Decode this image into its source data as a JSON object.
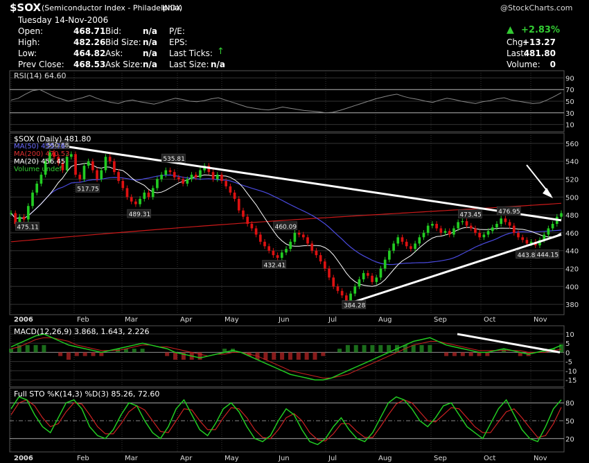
{
  "header": {
    "symbol": "$SOX",
    "name": "(Semiconductor Index - Philadelphia)",
    "exchange": "INDX",
    "watermark": "@StockCharts.com",
    "date": "Tuesday 14-Nov-2006",
    "quote": {
      "open_label": "Open:",
      "open": "468.71",
      "high_label": "High:",
      "high": "482.26",
      "low_label": "Low:",
      "low": "464.82",
      "prev_label": "Prev Close:",
      "prev": "468.53",
      "bid_label": "Bid:",
      "bid": "n/a",
      "bidsize_label": "Bid Size:",
      "bidsize": "n/a",
      "ask_label": "Ask:",
      "ask": "n/a",
      "asksize_label": "Ask Size:",
      "asksize": "n/a",
      "pe_label": "P/E:",
      "eps_label": "EPS:",
      "lastticks_label": "Last Ticks:",
      "lastsize_label": "Last Size:",
      "lastsize": "n/a",
      "pct": "+2.83%",
      "chg_label": "Chg:",
      "chg": "+13.27",
      "last_label": "Last:",
      "last": "481.80",
      "vol_label": "Volume:",
      "vol": "0"
    }
  },
  "colors": {
    "up": "#22cc22",
    "down": "#dd1111",
    "ma50": "#4a4adf",
    "ma200": "#cc1a1a",
    "ma20": "#ffffff",
    "grid": "#333333",
    "panel": "#000000",
    "macd_line": "#22cc22",
    "signal": "#cc2222",
    "sto_k": "#22cc22",
    "sto_d": "#cc2222",
    "rsi": "#888888",
    "trend": "#ffffff"
  },
  "chart_data": [
    {
      "type": "line",
      "panel": "rsi",
      "legend": "RSI(14) 64.60",
      "yticks": [
        10,
        30,
        50,
        70,
        90
      ],
      "ylim": [
        0,
        100
      ],
      "refs": [
        30,
        70
      ],
      "values": [
        52,
        55,
        62,
        68,
        70,
        64,
        58,
        54,
        50,
        53,
        56,
        60,
        55,
        51,
        48,
        46,
        50,
        52,
        49,
        47,
        45,
        48,
        52,
        55,
        53,
        50,
        49,
        51,
        54,
        56,
        52,
        48,
        44,
        40,
        38,
        36,
        35,
        37,
        40,
        38,
        36,
        34,
        33,
        32,
        30,
        31,
        34,
        38,
        42,
        46,
        50,
        54,
        57,
        60,
        62,
        58,
        55,
        53,
        50,
        48,
        52,
        55,
        53,
        50,
        48,
        46,
        49,
        51,
        54,
        56,
        52,
        50,
        48,
        46,
        47,
        52,
        58,
        64.6
      ]
    },
    {
      "type": "candlestick",
      "panel": "price",
      "legend": [
        "$SOX (Daily) 481.80",
        "MA(50) 455.76",
        "MA(200) 470.53",
        "MA(20) 456.45",
        "Volume undef"
      ],
      "ylim": [
        370,
        570
      ],
      "yticks": [
        380,
        400,
        420,
        440,
        460,
        480,
        500,
        520,
        540,
        560
      ],
      "x_months": [
        "2006",
        "Feb",
        "Mar",
        "Apr",
        "May",
        "Jun",
        "Jul",
        "Aug",
        "Sep",
        "Oct",
        "Nov"
      ],
      "close": [
        482,
        470,
        478,
        475,
        490,
        505,
        515,
        525,
        540,
        550,
        545,
        538,
        530,
        545,
        548,
        525,
        520,
        535,
        540,
        530,
        520,
        530,
        545,
        540,
        528,
        518,
        510,
        500,
        495,
        492,
        498,
        505,
        500,
        510,
        520,
        525,
        530,
        528,
        522,
        520,
        515,
        520,
        525,
        522,
        530,
        535,
        528,
        520,
        525,
        518,
        512,
        505,
        498,
        485,
        478,
        470,
        465,
        458,
        450,
        445,
        440,
        435,
        432,
        438,
        442,
        450,
        460,
        458,
        455,
        448,
        440,
        435,
        428,
        420,
        410,
        400,
        395,
        390,
        384,
        392,
        400,
        408,
        415,
        412,
        405,
        410,
        420,
        430,
        440,
        448,
        455,
        450,
        445,
        442,
        448,
        455,
        460,
        468,
        470,
        465,
        460,
        462,
        458,
        465,
        472,
        473,
        468,
        465,
        460,
        455,
        458,
        462,
        466,
        470,
        476,
        472,
        468,
        460,
        455,
        452,
        448,
        450,
        446,
        452,
        458,
        465,
        470,
        478,
        482
      ],
      "annotations": [
        {
          "label": "475.11",
          "value": 475.11
        },
        {
          "label": "550.88",
          "value": 550.88
        },
        {
          "label": "517.75",
          "value": 517.75
        },
        {
          "label": "489.31",
          "value": 489.31
        },
        {
          "label": "535.81",
          "value": 535.81
        },
        {
          "label": "460.09",
          "value": 460.09
        },
        {
          "label": "432.41",
          "value": 432.41
        },
        {
          "label": "384.28",
          "value": 384.28
        },
        {
          "label": "473.45",
          "value": 473.45
        },
        {
          "label": "476.95",
          "value": 476.95
        },
        {
          "label": "443.81",
          "value": 443.81
        },
        {
          "label": "444.15",
          "value": 444.15
        }
      ]
    },
    {
      "type": "line",
      "panel": "macd",
      "legend": "MACD(12,26,9) 3.868, 1.643, 2.226",
      "ylim": [
        -18,
        13
      ],
      "yticks": [
        -15,
        -10,
        -5,
        0,
        5,
        10
      ],
      "values": [
        3,
        5,
        7,
        9,
        10,
        8,
        6,
        4,
        3,
        2,
        1,
        0,
        1,
        2,
        3,
        4,
        5,
        4,
        3,
        2,
        0,
        -1,
        -2,
        -3,
        -2,
        -1,
        0,
        1,
        0,
        -2,
        -4,
        -6,
        -8,
        -10,
        -12,
        -13,
        -14,
        -15,
        -15,
        -14,
        -12,
        -10,
        -8,
        -6,
        -4,
        -2,
        0,
        2,
        4,
        6,
        7,
        8,
        6,
        4,
        3,
        2,
        1,
        0,
        0,
        1,
        2,
        1,
        0,
        -1,
        0,
        1,
        2,
        3.868
      ],
      "signal": [
        2,
        3,
        5,
        7,
        8,
        8,
        7,
        6,
        4,
        3,
        2,
        1,
        1,
        1,
        2,
        3,
        4,
        4,
        3,
        3,
        2,
        1,
        0,
        -1,
        -2,
        -1,
        -1,
        0,
        0,
        -1,
        -2,
        -4,
        -6,
        -8,
        -10,
        -11,
        -12,
        -13,
        -14,
        -14,
        -13,
        -12,
        -10,
        -8,
        -6,
        -4,
        -2,
        0,
        2,
        4,
        5,
        6,
        6,
        5,
        4,
        3,
        2,
        1,
        1,
        1,
        1,
        1,
        1,
        0,
        0,
        0,
        1,
        1.643
      ]
    },
    {
      "type": "line",
      "panel": "sto",
      "legend": "Full STO %K(14,3) %D(3) 85.26, 72.60",
      "ylim": [
        0,
        100
      ],
      "yticks": [
        20,
        50,
        80
      ],
      "refs": [
        20,
        80
      ],
      "k": [
        70,
        90,
        85,
        60,
        40,
        30,
        55,
        80,
        85,
        70,
        40,
        25,
        20,
        35,
        60,
        80,
        75,
        50,
        30,
        20,
        40,
        70,
        85,
        60,
        35,
        25,
        45,
        70,
        80,
        65,
        40,
        20,
        15,
        25,
        50,
        70,
        60,
        35,
        15,
        10,
        20,
        40,
        55,
        35,
        20,
        15,
        30,
        55,
        80,
        90,
        85,
        70,
        50,
        40,
        55,
        75,
        80,
        60,
        40,
        30,
        20,
        45,
        70,
        85,
        60,
        35,
        20,
        15,
        40,
        70,
        85.26
      ],
      "d": [
        60,
        80,
        85,
        75,
        55,
        40,
        45,
        65,
        80,
        78,
        60,
        40,
        28,
        28,
        45,
        65,
        75,
        68,
        50,
        32,
        30,
        50,
        70,
        68,
        50,
        35,
        35,
        55,
        72,
        70,
        55,
        35,
        22,
        20,
        35,
        55,
        62,
        50,
        30,
        18,
        16,
        28,
        45,
        45,
        32,
        22,
        22,
        40,
        60,
        78,
        85,
        80,
        65,
        50,
        48,
        60,
        72,
        70,
        55,
        40,
        30,
        30,
        48,
        65,
        70,
        55,
        38,
        22,
        25,
        45,
        72.6
      ]
    }
  ],
  "xaxis_bottom": [
    "2006",
    "Feb",
    "Mar",
    "Apr",
    "May",
    "Jun",
    "Jul",
    "Aug",
    "Sep",
    "Oct",
    "Nov"
  ]
}
